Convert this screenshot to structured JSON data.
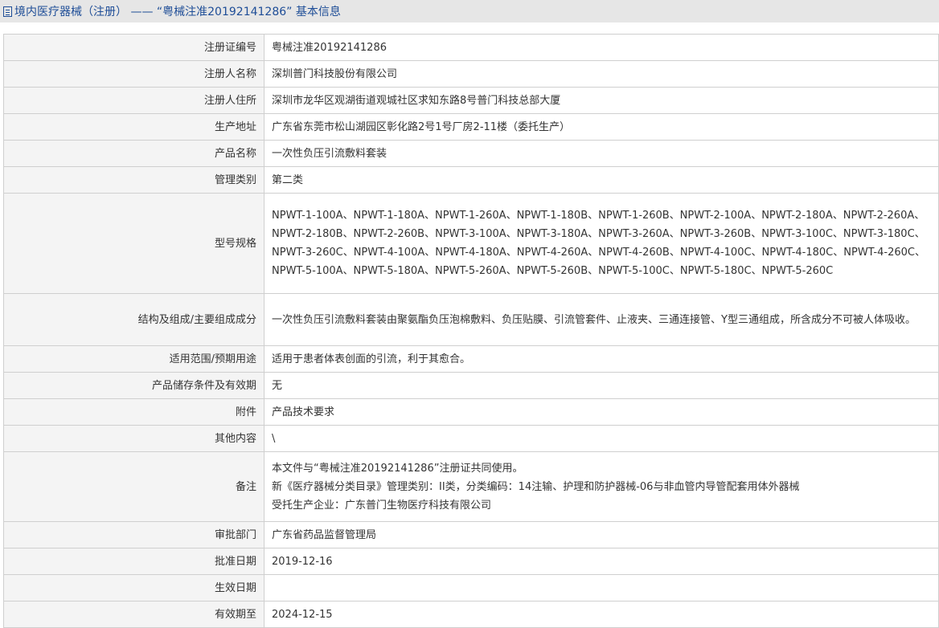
{
  "header": {
    "title": "境内医疗器械（注册） —— “粤械注准20192141286” 基本信息"
  },
  "rows": [
    {
      "label": "注册证编号",
      "value": "粤械注准20192141286"
    },
    {
      "label": "注册人名称",
      "value": "深圳普门科技股份有限公司"
    },
    {
      "label": "注册人住所",
      "value": "深圳市龙华区观湖街道观城社区求知东路8号普门科技总部大厦"
    },
    {
      "label": "生产地址",
      "value": "广东省东莞市松山湖园区彰化路2号1号厂房2-11楼（委托生产）"
    },
    {
      "label": "产品名称",
      "value": "一次性负压引流敷料套装"
    },
    {
      "label": "管理类别",
      "value": "第二类"
    },
    {
      "label": "型号规格",
      "value": "NPWT-1-100A、NPWT-1-180A、NPWT-1-260A、NPWT-1-180B、NPWT-1-260B、NPWT-2-100A、NPWT-2-180A、NPWT-2-260A、NPWT-2-180B、NPWT-2-260B、NPWT-3-100A、NPWT-3-180A、NPWT-3-260A、NPWT-3-260B、NPWT-3-100C、NPWT-3-180C、NPWT-3-260C、NPWT-4-100A、NPWT-4-180A、NPWT-4-260A、NPWT-4-260B、NPWT-4-100C、NPWT-4-180C、NPWT-4-260C、NPWT-5-100A、NPWT-5-180A、NPWT-5-260A、NPWT-5-260B、NPWT-5-100C、NPWT-5-180C、NPWT-5-260C"
    },
    {
      "label": "结构及组成/主要组成成分",
      "value": "一次性负压引流敷料套装由聚氨酯负压泡棉敷料、负压贴膜、引流管套件、止液夹、三通连接管、Y型三通组成，所含成分不可被人体吸收。"
    },
    {
      "label": "适用范围/预期用途",
      "value": "适用于患者体表创面的引流，利于其愈合。"
    },
    {
      "label": "产品储存条件及有效期",
      "value": "无"
    },
    {
      "label": "附件",
      "value": "产品技术要求"
    },
    {
      "label": "其他内容",
      "value": "\\"
    },
    {
      "label": "备注",
      "value_lines": [
        "本文件与“粤械注准20192141286”注册证共同使用。",
        "新《医疗器械分类目录》管理类别：II类，分类编码：14注输、护理和防护器械-06与非血管内导管配套用体外器械",
        "受托生产企业：广东普门生物医疗科技有限公司"
      ]
    },
    {
      "label": "审批部门",
      "value": "广东省药品监督管理局"
    },
    {
      "label": "批准日期",
      "value": "2019-12-16"
    },
    {
      "label": "生效日期",
      "value": ""
    },
    {
      "label": "有效期至",
      "value": "2024-12-15"
    }
  ]
}
